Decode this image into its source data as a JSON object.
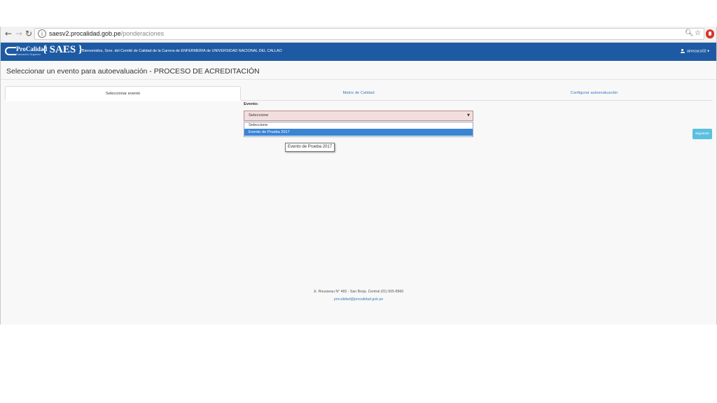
{
  "browser": {
    "url_host": "saesv2.procalidad.gob.pe",
    "url_path": "/ponderaciones",
    "icons": [
      "back-arrow-icon",
      "forward-arrow-icon",
      "reload-icon",
      "info-icon",
      "zoom-icon",
      "star-icon",
      "extension-icon"
    ]
  },
  "header": {
    "logo_text": "ProCalidad",
    "logo_subtext": "Educación Superior",
    "app_name": "{ SAES }",
    "welcome": "Bienvenidos, Sres. del Comité de Calidad de la Carrera de ENFERMERIA de UNIVERSIDAD NACIONAL DEL CALLAO",
    "user": "ainezacs02 ▾",
    "color": "#1d5aa3"
  },
  "page": {
    "title": "Seleccionar un evento para autoevaluación - PROCESO DE ACREDITACIÓN"
  },
  "tabs": [
    {
      "label": "Seleccionar evento",
      "active": true
    },
    {
      "label": "Matriz de Calidad",
      "active": false
    },
    {
      "label": "Configurar autoevaluación",
      "active": false
    }
  ],
  "form": {
    "event_label": "Evento:",
    "select_value": "Seleccione",
    "options": [
      "Seleccione",
      "Evento de Prueba 2017"
    ],
    "highlighted_option": "Evento de Prueba 2017",
    "tooltip": "Evento de Prueba 2017",
    "next_button": "Siguiente"
  },
  "footer": {
    "address": "Jr. Rousseau N° 465 - San Borja. Central (01) 605-8960",
    "email": "procalidad@procalidad.gob.pe"
  }
}
